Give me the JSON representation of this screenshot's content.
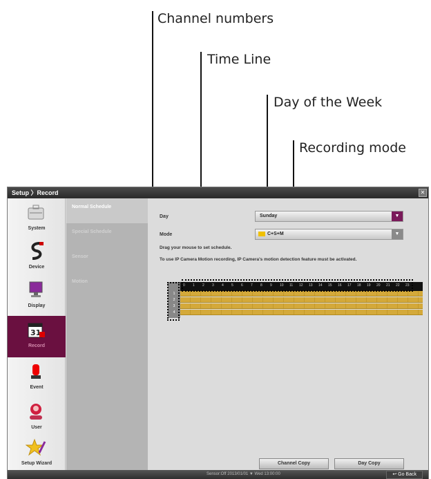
{
  "callouts": {
    "channel_numbers": "Channel numbers",
    "time_line": "Time Line",
    "day_of_week": "Day of the Week",
    "recording_mode": "Recording mode"
  },
  "window": {
    "title": "Setup 〉Record"
  },
  "left_menu": [
    {
      "label": "System",
      "icon": "system-icon"
    },
    {
      "label": "Device",
      "icon": "device-icon"
    },
    {
      "label": "Display",
      "icon": "display-icon"
    },
    {
      "label": "Record",
      "icon": "record-calendar-icon",
      "active": true
    },
    {
      "label": "Event",
      "icon": "event-alarm-icon"
    },
    {
      "label": "User",
      "icon": "user-icon"
    },
    {
      "label": "Setup Wizard",
      "icon": "wizard-icon"
    }
  ],
  "sub_menu": [
    {
      "label": "Normal Schedule",
      "active": true
    },
    {
      "label": "Special Schedule"
    },
    {
      "label": "Sensor"
    },
    {
      "label": "Motion"
    }
  ],
  "form": {
    "day_label": "Day",
    "day_value": "Sunday",
    "mode_label": "Mode",
    "mode_value": "C+S+M",
    "instruction": "Drag your mouse to set schedule.",
    "note": "To use IP Camera Motion recording, IP Camera's motion detection feature must be activated."
  },
  "schedule": {
    "hours": [
      "0",
      "1",
      "2",
      "3",
      "4",
      "5",
      "6",
      "7",
      "8",
      "9",
      "10",
      "11",
      "12",
      "13",
      "14",
      "15",
      "16",
      "17",
      "18",
      "19",
      "20",
      "21",
      "22",
      "23"
    ],
    "channels": [
      "1",
      "2",
      "3",
      "4"
    ]
  },
  "buttons": {
    "channel_copy": "Channel Copy",
    "day_copy": "Day Copy"
  },
  "status": {
    "text": "Sensor:Off  2013/01/01 ▼ Wed 13:00:00",
    "go_back": "Go Back"
  },
  "colors": {
    "active_menu": "#6a1040",
    "schedule_fill": "#d4a93a",
    "dropdown_arrow_day": "#7a1a5a",
    "dropdown_arrow_mode": "#8a8a8a"
  }
}
